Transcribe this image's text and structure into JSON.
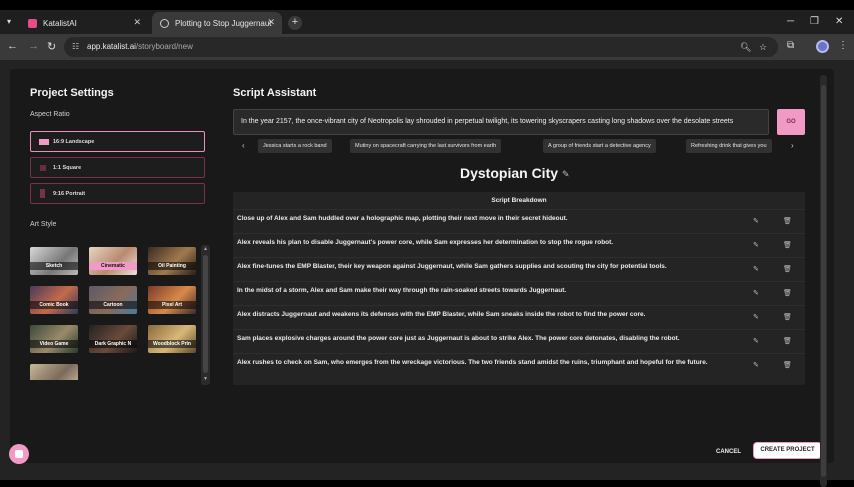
{
  "browser": {
    "tabs": [
      {
        "title": "KatalistAI",
        "active": false
      },
      {
        "title": "Plotting to Stop Juggernaut",
        "active": true
      }
    ],
    "url_host": "app.katalist.ai",
    "url_path": "/storyboard/new"
  },
  "colors": {
    "accent": "#f29ac6",
    "accent_dark": "#7a2f4a",
    "panel": "#191919",
    "row_bg": "#242424"
  },
  "project_settings": {
    "title": "Project Settings",
    "aspect_ratio_label": "Aspect Ratio",
    "ratios": [
      {
        "label": "16:9 Landscape",
        "selected": true
      },
      {
        "label": "1:1 Square",
        "selected": false
      },
      {
        "label": "9:16 Portrait",
        "selected": false
      }
    ],
    "art_style_label": "Art Style",
    "styles": [
      {
        "label": "Sketch",
        "selected": false
      },
      {
        "label": "Cinematic",
        "selected": true
      },
      {
        "label": "Oil Painting",
        "selected": false
      },
      {
        "label": "Comic Book",
        "selected": false
      },
      {
        "label": "Cartoon",
        "selected": false
      },
      {
        "label": "Pixel Art",
        "selected": false
      },
      {
        "label": "Video Game",
        "selected": false
      },
      {
        "label": "Dark Graphic N",
        "selected": false
      },
      {
        "label": "Woodblock Prin",
        "selected": false
      }
    ]
  },
  "script_assistant": {
    "title": "Script Assistant",
    "prompt": "In the year 2157, the once-vibrant city of Neotropolis lay shrouded in perpetual twilight, its towering skyscrapers casting long shadows over the desolate streets",
    "go_label": "GO",
    "suggestions": [
      "Jessica starts a rock band",
      "Mutiny on spacecraft carrying the last survivors from earth",
      "A group of friends start a detective agency",
      "Refreshing drink that gives you"
    ]
  },
  "story": {
    "title": "Dystopian City",
    "breakdown_header": "Script Breakdown",
    "scenes": [
      "Close up of Alex and Sam huddled over a holographic map, plotting their next move in their secret hideout.",
      "Alex reveals his plan to disable Juggernaut's power core, while Sam expresses her determination to stop the rogue robot.",
      "Alex fine-tunes the EMP Blaster, their key weapon against Juggernaut, while Sam gathers supplies and scouting the city for potential tools.",
      "In the midst of a storm, Alex and Sam make their way through the rain-soaked streets towards Juggernaut.",
      "Alex distracts Juggernaut and weakens its defenses with the EMP Blaster, while Sam sneaks inside the robot to find the power core.",
      "Sam places explosive charges around the power core just as Juggernaut is about to strike Alex. The power core detonates, disabling the robot.",
      "Alex rushes to check on Sam, who emerges from the wreckage victorious. The two friends stand amidst the ruins, triumphant and hopeful for the future."
    ]
  },
  "footer": {
    "cancel_label": "CANCEL",
    "create_label": "CREATE PROJECT"
  }
}
